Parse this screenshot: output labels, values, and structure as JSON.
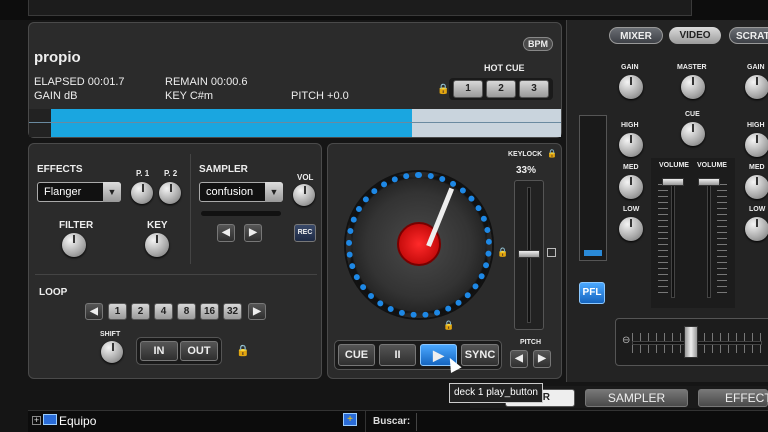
{
  "deck": {
    "title": "propio",
    "bpm_label": "BPM",
    "elapsed": "ELAPSED 00:01.7",
    "remain": "REMAIN 00:00.6",
    "gain": "GAIN dB",
    "key": "KEY C#m",
    "pitch": "PITCH +0.0",
    "hot_cue_label": "HOT CUE",
    "hot_cues": [
      "1",
      "2",
      "3"
    ],
    "waveform_progress": 0.72,
    "colors": {
      "waveform": "#1aa6e0",
      "accent": "#1e88e5",
      "platter_center": "#e01010"
    }
  },
  "effects": {
    "label": "EFFECTS",
    "selected": "Flanger",
    "p1": "P. 1",
    "p2": "P. 2",
    "filter": "FILTER",
    "key": "KEY"
  },
  "sampler": {
    "label": "SAMPLER",
    "selected": "confusion",
    "vol": "VOL",
    "rec": "REC"
  },
  "loop": {
    "label": "LOOP",
    "sizes": [
      "1",
      "2",
      "4",
      "8",
      "16",
      "32"
    ],
    "shift": "SHIFT",
    "in": "IN",
    "out": "OUT"
  },
  "transport": {
    "keylock": "KEYLOCK",
    "pitch_percent": "33%",
    "pitch_label": "PITCH",
    "cue": "CUE",
    "pause": "II",
    "play": "▶",
    "sync": "SYNC",
    "tooltip": "deck 1 play_button"
  },
  "mixer": {
    "tabs": [
      "MIXER",
      "VIDEO",
      "SCRATC"
    ],
    "gain": "GAIN",
    "master": "MASTER",
    "cue": "CUE",
    "high": "HIGH",
    "med": "MED",
    "low": "LOW",
    "volume": "VOLUME",
    "pfl": "PFL"
  },
  "bottom_tabs": {
    "partial": "R",
    "sampler": "SAMPLER",
    "effects": "EFFECTS"
  },
  "browser": {
    "folder": "Equipo",
    "search_label": "Buscar:"
  }
}
